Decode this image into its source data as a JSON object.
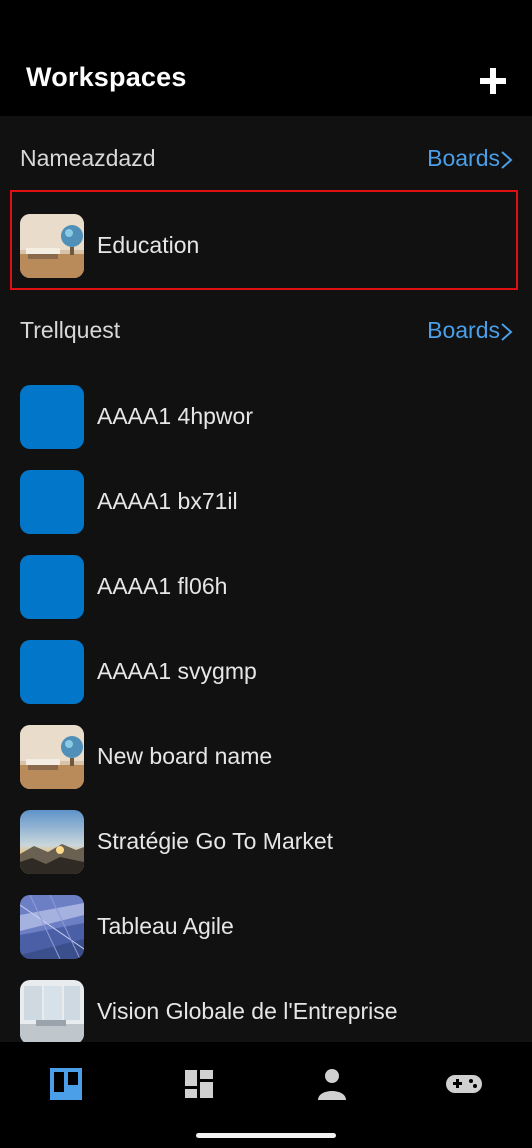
{
  "header": {
    "title": "Workspaces",
    "add_icon": "plus-icon"
  },
  "workspaces": [
    {
      "name": "Nameazdazd",
      "boards_link": "Boards",
      "boards": [
        {
          "name": "Education",
          "thumb": "image-desk-globe",
          "selected": true
        }
      ]
    },
    {
      "name": "Trellquest",
      "boards_link": "Boards",
      "boards": [
        {
          "name": "AAAA1 4hpwor",
          "thumb": "solid-blue"
        },
        {
          "name": "AAAA1 bx71il",
          "thumb": "solid-blue"
        },
        {
          "name": "AAAA1 fl06h",
          "thumb": "solid-blue"
        },
        {
          "name": "AAAA1 svygmp",
          "thumb": "solid-blue"
        },
        {
          "name": "New board name",
          "thumb": "image-desk-globe"
        },
        {
          "name": "Stratégie Go To Market",
          "thumb": "image-sunset-mountains"
        },
        {
          "name": "Tableau Agile",
          "thumb": "image-architecture"
        },
        {
          "name": "Vision Globale de l'Entreprise",
          "thumb": "image-office"
        }
      ]
    }
  ],
  "bottom_nav": [
    {
      "name": "boards-tab",
      "icon": "trello-board-icon",
      "active": true
    },
    {
      "name": "dashboard-tab",
      "icon": "dashboard-grid-icon",
      "active": false
    },
    {
      "name": "account-tab",
      "icon": "person-icon",
      "active": false
    },
    {
      "name": "game-tab",
      "icon": "gamepad-icon",
      "active": false
    }
  ],
  "colors": {
    "accent": "#4a9fe8",
    "board_blue": "#0277c9",
    "active_tab": "#4a9fe8",
    "inactive_tab": "#d0d0d0",
    "highlight_border": "#e01010"
  }
}
